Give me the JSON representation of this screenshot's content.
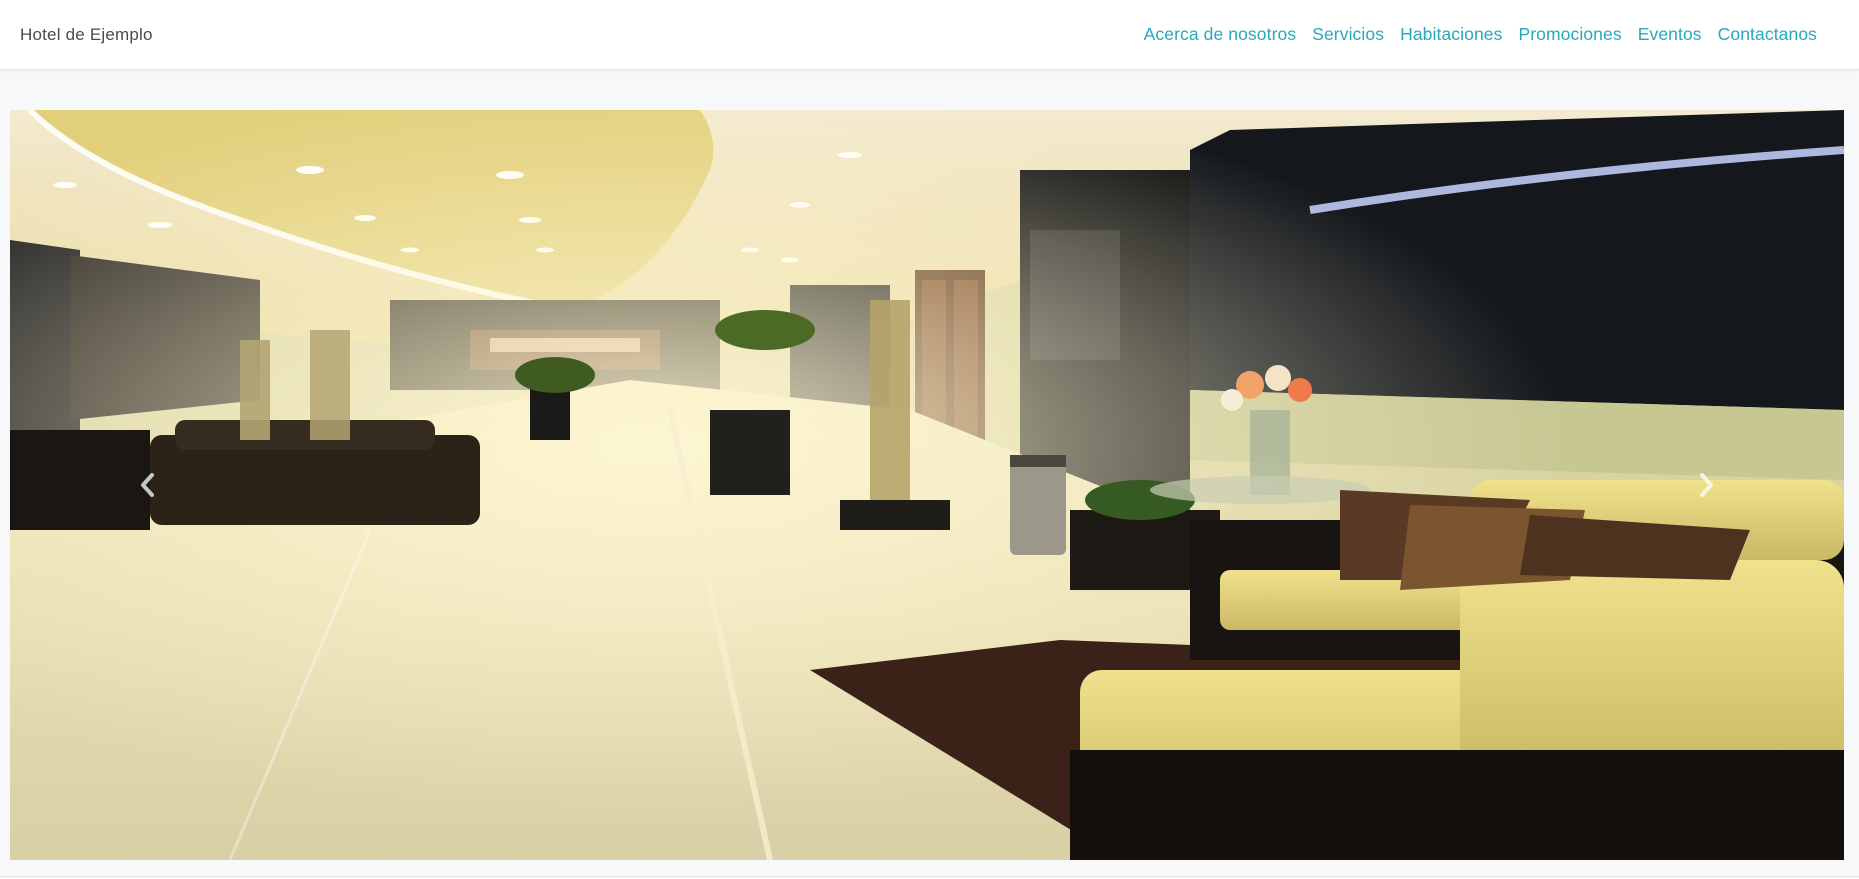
{
  "navbar": {
    "brand": "Hotel de Ejemplo",
    "links": [
      {
        "label": "Acerca de nosotros"
      },
      {
        "label": "Servicios"
      },
      {
        "label": "Habitaciones"
      },
      {
        "label": "Promociones"
      },
      {
        "label": "Eventos"
      },
      {
        "label": "Contactanos"
      }
    ]
  },
  "carousel": {
    "image": "hotel-lobby-photo",
    "prev_icon": "chevron-left-icon",
    "next_icon": "chevron-right-icon"
  },
  "colors": {
    "brand_text": "#444b52",
    "link": "#2aa7bd",
    "navbar_bg": "#ffffff",
    "page_bg": "#f7f8f9"
  }
}
